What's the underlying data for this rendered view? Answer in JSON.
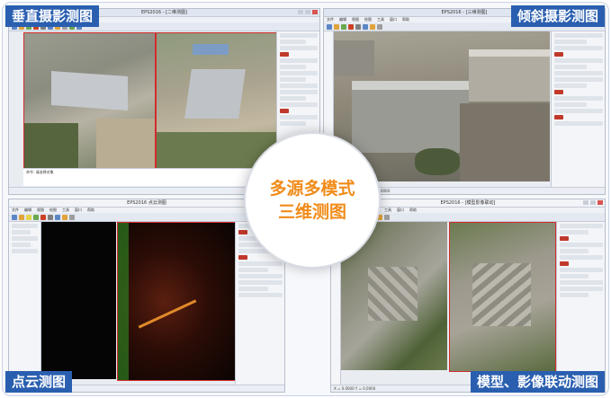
{
  "center": {
    "line1": "多源多模式",
    "line2": "三维测图"
  },
  "labels": {
    "vertical": "垂直摄影测图",
    "oblique": "倾斜摄影测图",
    "pointcloud": "点云测图",
    "linked": "模型、影像联动测图"
  },
  "colors": {
    "label_bg": "#2a5fb0",
    "center_text": "#f08c1a",
    "accent_red": "#c0392b"
  },
  "windows": {
    "top_left": {
      "title": "EPS2016 - [二维测图]",
      "menu": [
        "文件",
        "编辑",
        "视图",
        "绘图",
        "工具",
        "窗口",
        "帮助"
      ],
      "status": "命令: 请选择对象"
    },
    "top_right": {
      "title": "EPS2016 - [三维测图]",
      "menu": [
        "文件",
        "编辑",
        "视图",
        "绘图",
        "工具",
        "窗口",
        "帮助"
      ],
      "status": "X = 0.0000 Y = 0.0000 Z = 0.0000"
    },
    "bottom_left": {
      "title": "EPS2016 点云测图",
      "menu": [
        "文件",
        "编辑",
        "视图",
        "绘图",
        "工具",
        "窗口",
        "帮助"
      ],
      "status": "命令:"
    },
    "bottom_right": {
      "title": "EPS2016 - [模型影像联动]",
      "menu": [
        "文件",
        "编辑",
        "视图",
        "绘图",
        "工具",
        "窗口",
        "帮助"
      ],
      "status": "X = 0.0000 Y = 0.0000"
    }
  }
}
